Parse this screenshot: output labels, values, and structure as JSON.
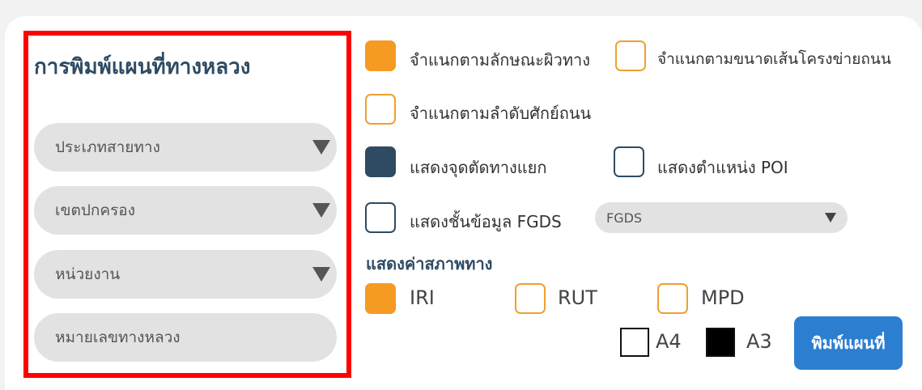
{
  "panel": {
    "title": "การพิมพ์แผนที่ทางหลวง",
    "road_type_select": "ประเภทสายทาง",
    "district_select": "เขตปกครอง",
    "agency_select": "หน่วยงาน",
    "highway_number_placeholder": "หมายเลขทางหลวง"
  },
  "options": {
    "classify_surface": {
      "label": "จำแนกตามลักษณะผิวทาง",
      "checked": true
    },
    "classify_network_size": {
      "label": "จำแนกตามขนาดเส้นโครงข่ายถนน",
      "checked": false
    },
    "classify_road_hierarchy": {
      "label": "จำแนกตามลำดับศักย์ถนน",
      "checked": false
    },
    "show_junctions": {
      "label": "แสดงจุดตัดทางแยก",
      "checked": true
    },
    "show_poi": {
      "label": "แสดงตำแหน่ง POI",
      "checked": false
    },
    "show_fgds": {
      "label": "แสดงชั้นข้อมูล FGDS",
      "checked": false
    },
    "fgds_select": "FGDS"
  },
  "condition": {
    "heading": "แสดงค่าสภาพทาง",
    "iri": {
      "label": "IRI",
      "checked": true
    },
    "rut": {
      "label": "RUT",
      "checked": false
    },
    "mpd": {
      "label": "MPD",
      "checked": false
    }
  },
  "paper": {
    "a4": {
      "label": "A4",
      "selected": false
    },
    "a3": {
      "label": "A3",
      "selected": true
    }
  },
  "print_button": "พิมพ์แผนที่",
  "colors": {
    "accent_orange": "#f59a23",
    "navy": "#2f4b63",
    "highlight_red": "#ff0000",
    "button_blue": "#2c7fd0"
  }
}
